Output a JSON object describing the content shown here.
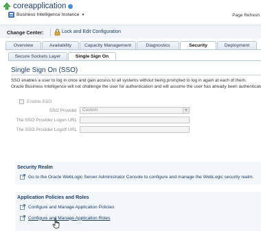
{
  "header": {
    "app_title": "coreapplication",
    "instance_label": "Business Intelligence Instance",
    "page_refresh": "Page Refresh"
  },
  "change_center": {
    "label": "Change Center:",
    "lock_link": "Lock and Edit Configuration"
  },
  "tabs": [
    {
      "label": "Overview",
      "active": false
    },
    {
      "label": "Availability",
      "active": false
    },
    {
      "label": "Capacity Management",
      "active": false
    },
    {
      "label": "Diagnostics",
      "active": false
    },
    {
      "label": "Security",
      "active": true
    },
    {
      "label": "Deployment",
      "active": false
    }
  ],
  "subtabs": [
    {
      "label": "Secure Sockets Layer",
      "active": false
    },
    {
      "label": "Single Sign On",
      "active": true
    }
  ],
  "sso": {
    "heading": "Single Sign On (SSO)",
    "description_line1": "SSO enables a user to log in once and gain access to all systems without being prompted to log in again at each of them.",
    "description_line2": "Oracle Business Intelligence will not challenge the user for authentication and will assume the user has already been authenticated.",
    "enable_label": "Enable SSO",
    "provider_label": "SSO Provider",
    "provider_value": "Custom",
    "logon_url_label": "The SSO Provider Logon URL",
    "logoff_url_label": "The SSO Provider Logoff URL"
  },
  "security_realm": {
    "heading": "Security Realm",
    "link": "Go to the Oracle WebLogic Server Administrator Console to configure and manage the WebLogic security realm."
  },
  "app_policies": {
    "heading": "Application Policies and Roles",
    "policies_link": "Configure and Manage Application Policies",
    "roles_link": "Configure and Manage Application Roles"
  },
  "colors": {
    "accent": "#1f3f6b",
    "link": "#1b3b66",
    "panel_bg": "#f3f6fa"
  },
  "icons": [
    "app-status-icon",
    "info-icon",
    "instance-icon",
    "lock-icon",
    "external-link-icon",
    "hand-cursor-icon"
  ]
}
